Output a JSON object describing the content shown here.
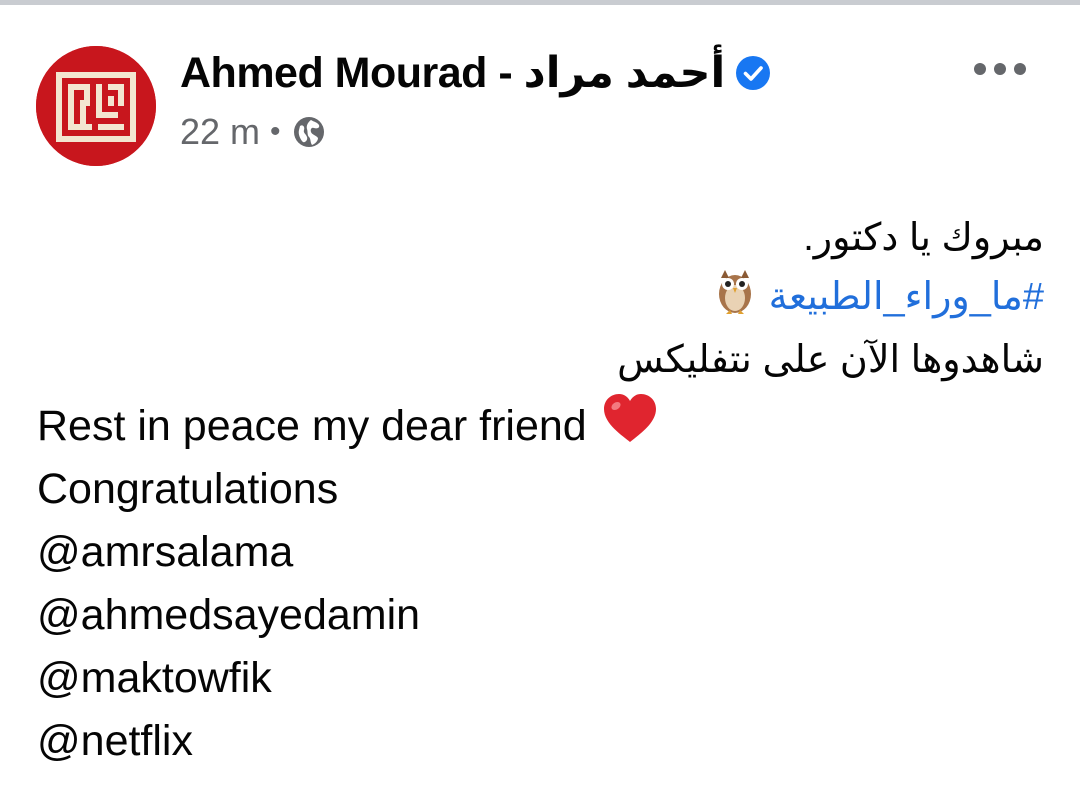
{
  "post": {
    "author": "Ahmed Mourad - أحمد مراد",
    "timestamp": "22 m",
    "meta_separator": "•",
    "audience_icon": "globe-icon",
    "verified_icon": "verified-badge-icon",
    "more_icon": "more-options-icon",
    "colors": {
      "link": "#216fdb",
      "verified": "#1877f2",
      "meta": "#65676b",
      "avatar_bg": "#c8161d"
    },
    "arabic_lines": {
      "line1": "مبروك يا دكتور.",
      "hashtag": "#ما_وراء_الطبيعة",
      "owl_icon": "owl-emoji",
      "line3": "شاهدوها الآن على نتفليكس"
    },
    "english_lines": {
      "rip": "Rest in peace my dear friend",
      "heart_icon": "red-heart-emoji",
      "congrats": "Congratulations",
      "mention1": "@amrsalama",
      "mention2": "@ahmedsayedamin",
      "mention3": "@maktowfik",
      "mention4": "@netflix"
    }
  }
}
